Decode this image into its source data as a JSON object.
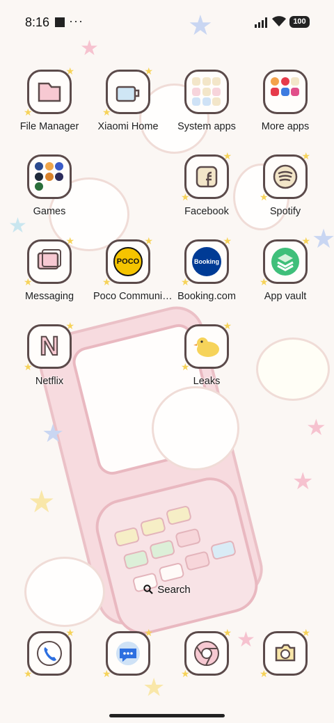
{
  "status_bar": {
    "time": "8:16",
    "more": "···",
    "battery": "100"
  },
  "apps": [
    {
      "label": "File Manager",
      "icon": "file-manager-icon"
    },
    {
      "label": "Xiaomi Home",
      "icon": "xiaomi-home-icon"
    },
    {
      "label": "System apps",
      "icon": "system-apps-folder-icon"
    },
    {
      "label": "More apps",
      "icon": "more-apps-folder-icon"
    },
    {
      "label": "Games",
      "icon": "games-folder-icon"
    },
    {
      "label": "Facebook",
      "icon": "facebook-icon"
    },
    {
      "label": "Spotify",
      "icon": "spotify-icon"
    },
    {
      "label": "Messaging",
      "icon": "messaging-icon"
    },
    {
      "label": "Poco Communi…",
      "icon": "poco-community-icon",
      "badge": "POCO"
    },
    {
      "label": "Booking.com",
      "icon": "booking-icon",
      "badge": "Booking"
    },
    {
      "label": "App vault",
      "icon": "app-vault-icon"
    },
    {
      "label": "Netflix",
      "icon": "netflix-icon",
      "badge": "N"
    },
    {
      "label": "Leaks",
      "icon": "leaks-icon"
    }
  ],
  "dock": [
    {
      "icon": "phone-icon"
    },
    {
      "icon": "messages-icon"
    },
    {
      "icon": "chrome-icon"
    },
    {
      "icon": "camera-icon"
    }
  ],
  "search": {
    "label": "Search"
  },
  "colors": {
    "tile_border": "#5b4a4a",
    "star_yellow": "#f6d35a",
    "wallpaper_pink": "#f7d7dc",
    "booking_blue": "#003b95",
    "poco_yellow": "#f5c400"
  }
}
